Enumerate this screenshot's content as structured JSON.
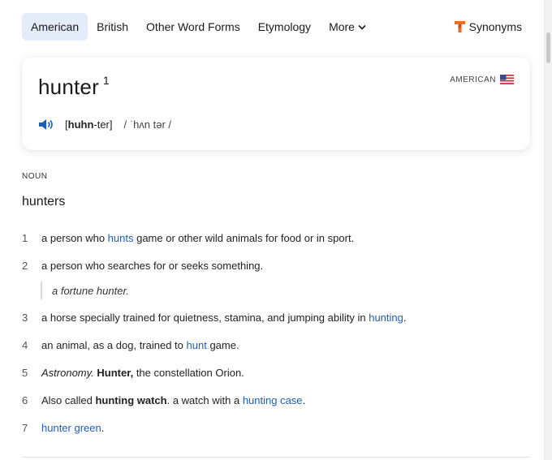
{
  "tabs": [
    {
      "label": "American",
      "active": true
    },
    {
      "label": "British",
      "active": false
    },
    {
      "label": "Other Word Forms",
      "active": false
    },
    {
      "label": "Etymology",
      "active": false
    },
    {
      "label": "More",
      "active": false
    }
  ],
  "synonyms_label": "Synonyms",
  "entry": {
    "word": "hunter",
    "homograph": "1",
    "region": "AMERICAN",
    "respell_bold": "huhn",
    "respell_rest": "-ter",
    "ipa": "/ ˈhʌn tər /"
  },
  "pos": "NOUN",
  "form": "hunters",
  "definitions": [
    {
      "num": "1",
      "before": "a person who ",
      "link": "hunts",
      "after": " game or other wild animals for food or in sport."
    },
    {
      "num": "2",
      "text": "a person who searches for or seeks something."
    },
    {
      "num": "3",
      "before": "a horse specially trained for quietness, stamina, and jumping ability in ",
      "link": "hunting",
      "after": "."
    },
    {
      "num": "4",
      "before": "an animal, as a dog, trained to ",
      "link": "hunt",
      "after": " game."
    },
    {
      "num": "5",
      "label": "Astronomy.",
      "bold": "Hunter,",
      "after": " the constellation Orion."
    },
    {
      "num": "6",
      "before": "Also called ",
      "bold": "hunting watch",
      "mid": ". a watch with a ",
      "link": "hunting case",
      "after": "."
    },
    {
      "num": "7",
      "link": "hunter green",
      "after": "."
    }
  ],
  "example_2": "a fortune hunter.",
  "colors": {
    "accent_link": "#1f5fb8",
    "active_tab_bg": "#e3ecf8",
    "brand_orange": "#f26b1d"
  }
}
